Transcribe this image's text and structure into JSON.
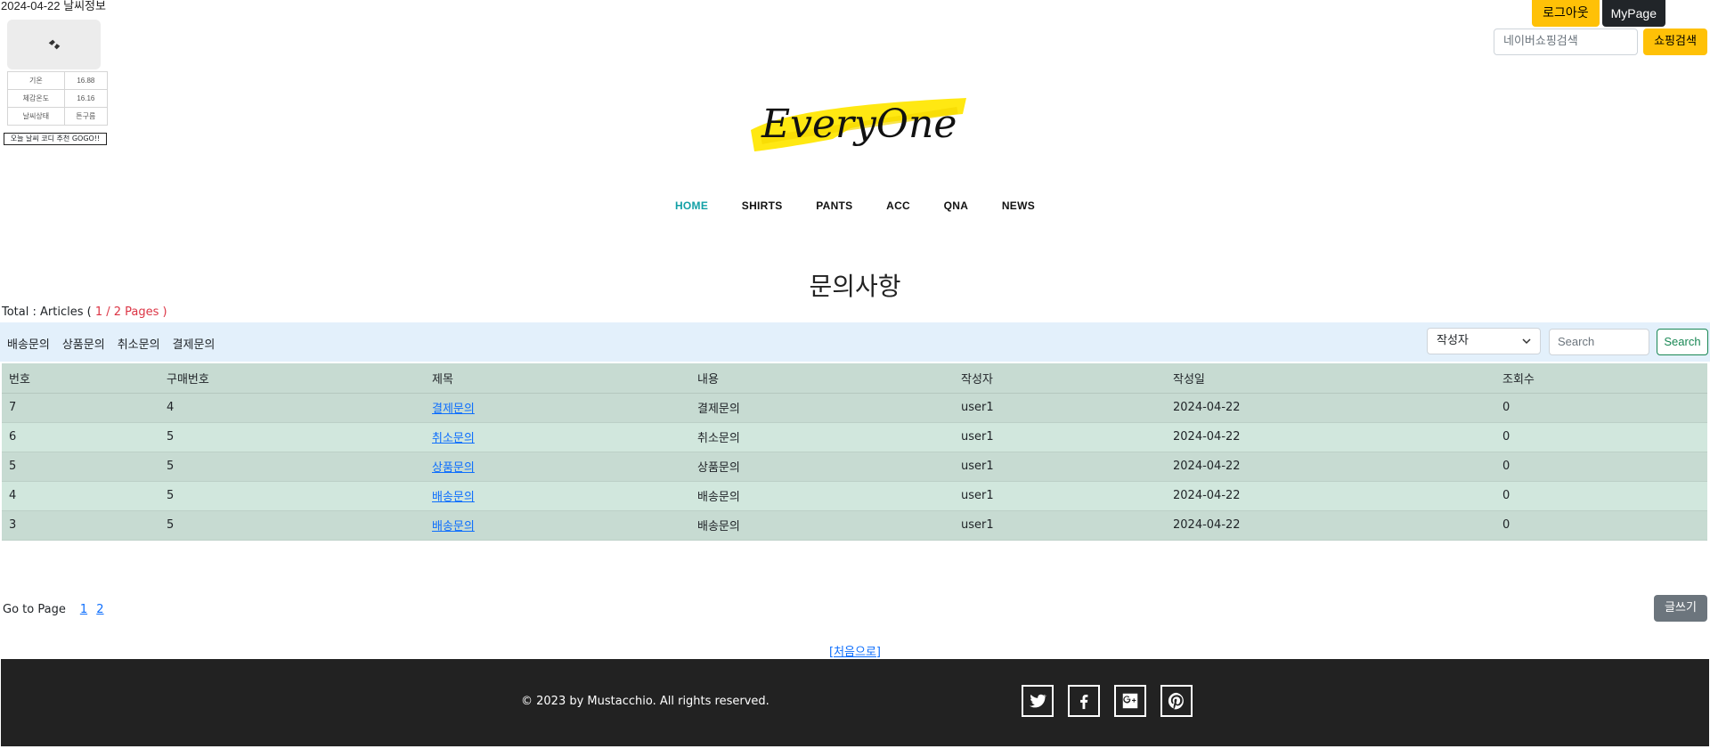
{
  "weather": {
    "date": "2024-04-22",
    "title": "날씨정보",
    "rows": [
      {
        "label": "기온",
        "value": "16.88"
      },
      {
        "label": "체감온도",
        "value": "16.16"
      },
      {
        "label": "날씨상태",
        "value": "튼구름"
      }
    ],
    "button": "오늘 날씨 코디 추천 GOGO!!"
  },
  "header": {
    "logout": "로그아웃",
    "mypage": "MyPage",
    "shop_placeholder": "네이버쇼핑검색",
    "shop_button": "쇼핑검색",
    "logo_text": "EveryOne"
  },
  "nav": [
    "HOME",
    "SHIRTS",
    "PANTS",
    "ACC",
    "QNA",
    "NEWS"
  ],
  "page_title": "문의사항",
  "total": {
    "prefix": "Total : Articles (",
    "pages": " 1 / 2 Pages ",
    "suffix": ")"
  },
  "filter": {
    "categories": [
      "배송문의",
      "상품문의",
      "취소문의",
      "결제문의"
    ],
    "select_value": "작성자",
    "search_placeholder": "Search",
    "search_button": "Search"
  },
  "table": {
    "headers": [
      "번호",
      "구매번호",
      "제목",
      "내용",
      "작성자",
      "작성일",
      "조회수"
    ],
    "rows": [
      [
        "7",
        "4",
        "결제문의",
        "결제문의",
        "user1",
        "2024-04-22",
        "0"
      ],
      [
        "6",
        "5",
        "취소문의",
        "취소문의",
        "user1",
        "2024-04-22",
        "0"
      ],
      [
        "5",
        "5",
        "상품문의",
        "상품문의",
        "user1",
        "2024-04-22",
        "0"
      ],
      [
        "4",
        "5",
        "배송문의",
        "배송문의",
        "user1",
        "2024-04-22",
        "0"
      ],
      [
        "3",
        "5",
        "배송문의",
        "배송문의",
        "user1",
        "2024-04-22",
        "0"
      ]
    ]
  },
  "pager": {
    "label": "Go to Page",
    "pages": [
      "1",
      "2"
    ]
  },
  "write_button": "글쓰기",
  "home_link": "[처음으로]",
  "footer": {
    "copyright": "© 2023 by Mustacchio. All rights reserved.",
    "socials": [
      "twitter-icon",
      "facebook-icon",
      "google-plus-icon",
      "pinterest-icon"
    ]
  },
  "colors": {
    "accent": "#12a0a6",
    "warning": "#ffc107",
    "table_row": "#d1e7dd",
    "filter_bg": "#e3f0fb",
    "footer_bg": "#222222"
  }
}
